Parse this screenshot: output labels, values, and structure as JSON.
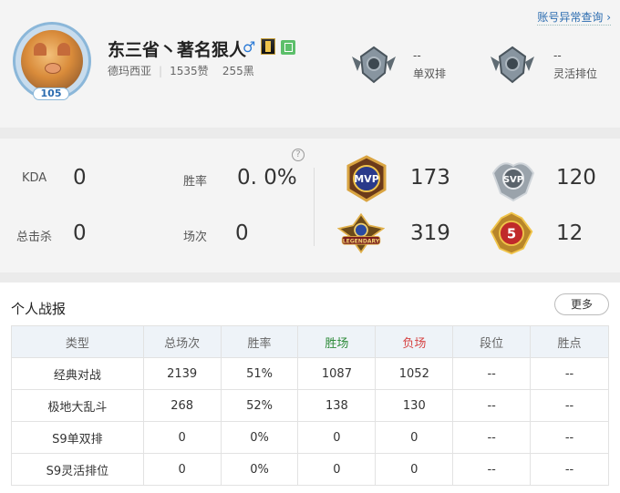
{
  "header": {
    "anomaly_link": "账号异常查询 ›",
    "level": "105",
    "player_name": "东三省丶著名狠人",
    "gender_symbol": "♂",
    "server": "德玛西亚",
    "likes": "1535赞",
    "blacks": "255黑",
    "ranks": [
      {
        "value": "--",
        "label": "单双排"
      },
      {
        "value": "--",
        "label": "灵活排位"
      }
    ]
  },
  "stats": {
    "help": "?",
    "kda_label": "KDA",
    "kda_value": "0",
    "winrate_label": "胜率",
    "winrate_value": "0. 0%",
    "kills_label": "总击杀",
    "kills_value": "0",
    "games_label": "场次",
    "games_value": "0",
    "honors": [
      {
        "icon": "mvp-badge-icon",
        "value": "173"
      },
      {
        "icon": "svp-badge-icon",
        "value": "120"
      },
      {
        "icon": "legendary-badge-icon",
        "value": "319"
      },
      {
        "icon": "penta-kill-badge-icon",
        "value": "12"
      }
    ]
  },
  "report": {
    "title": "个人战报",
    "more_label": "更多",
    "columns": [
      "类型",
      "总场次",
      "胜率",
      "胜场",
      "负场",
      "段位",
      "胜点"
    ],
    "rows": [
      [
        "经典对战",
        "2139",
        "51%",
        "1087",
        "1052",
        "--",
        "--"
      ],
      [
        "极地大乱斗",
        "268",
        "52%",
        "138",
        "130",
        "--",
        "--"
      ],
      [
        "S9单双排",
        "0",
        "0%",
        "0",
        "0",
        "--",
        "--"
      ],
      [
        "S9灵活排位",
        "0",
        "0%",
        "0",
        "0",
        "--",
        "--"
      ]
    ],
    "win_color": "#2e8b3a",
    "loss_color": "#d64545"
  }
}
